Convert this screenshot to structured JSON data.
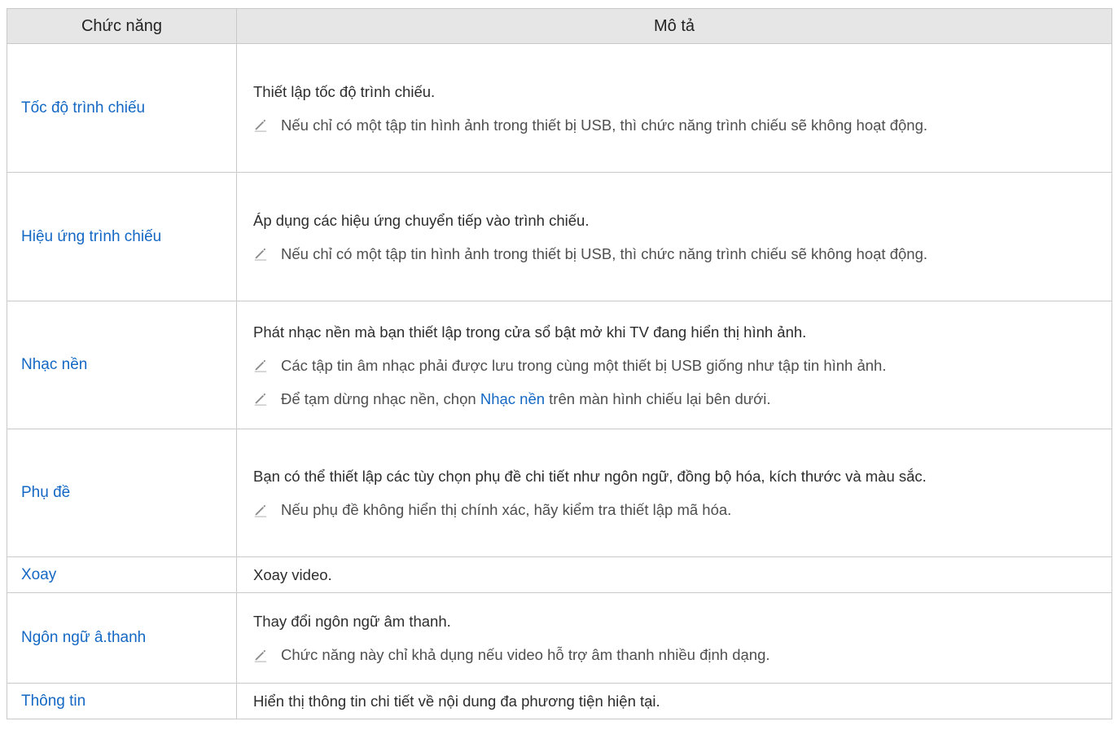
{
  "header": {
    "col_function": "Chức năng",
    "col_description": "Mô tả"
  },
  "rows": [
    {
      "function": "Tốc độ trình chiếu",
      "description": "Thiết lập tốc độ trình chiếu.",
      "notes": [
        "Nếu chỉ có một tập tin hình ảnh trong thiết bị USB, thì chức năng trình chiếu sẽ không hoạt động."
      ]
    },
    {
      "function": "Hiệu ứng trình chiếu",
      "description": "Áp dụng các hiệu ứng chuyển tiếp vào trình chiếu.",
      "notes": [
        "Nếu chỉ có một tập tin hình ảnh trong thiết bị USB, thì chức năng trình chiếu sẽ không hoạt động."
      ]
    },
    {
      "function": "Nhạc nền",
      "description": "Phát nhạc nền mà bạn thiết lập trong cửa sổ bật mở khi TV đang hiển thị hình ảnh.",
      "notes": [
        "Các tập tin âm nhạc phải được lưu trong cùng một thiết bị USB giống như tập tin hình ảnh."
      ],
      "note2": {
        "before": "Để tạm dừng nhạc nền, chọn ",
        "highlight": "Nhạc nền",
        "after": " trên màn hình chiếu lại bên dưới."
      }
    },
    {
      "function": "Phụ đề",
      "description": "Bạn có thể thiết lập các tùy chọn phụ đề chi tiết như ngôn ngữ, đồng bộ hóa, kích thước và màu sắc.",
      "notes": [
        "Nếu phụ đề không hiển thị chính xác, hãy kiểm tra thiết lập mã hóa."
      ]
    },
    {
      "function": "Xoay",
      "description": "Xoay video.",
      "notes": []
    },
    {
      "function": "Ngôn ngữ â.thanh",
      "description": "Thay đổi ngôn ngữ âm thanh.",
      "notes": [
        "Chức năng này chỉ khả dụng nếu video hỗ trợ âm thanh nhiều định dạng."
      ]
    },
    {
      "function": "Thông tin",
      "description": "Hiển thị thông tin chi tiết về nội dung đa phương tiện hiện tại.",
      "notes": []
    }
  ],
  "icons": {
    "note": "pencil-icon"
  },
  "colors": {
    "link": "#1468c4",
    "header_bg": "#e6e6e6",
    "border": "#c9c9c9"
  }
}
